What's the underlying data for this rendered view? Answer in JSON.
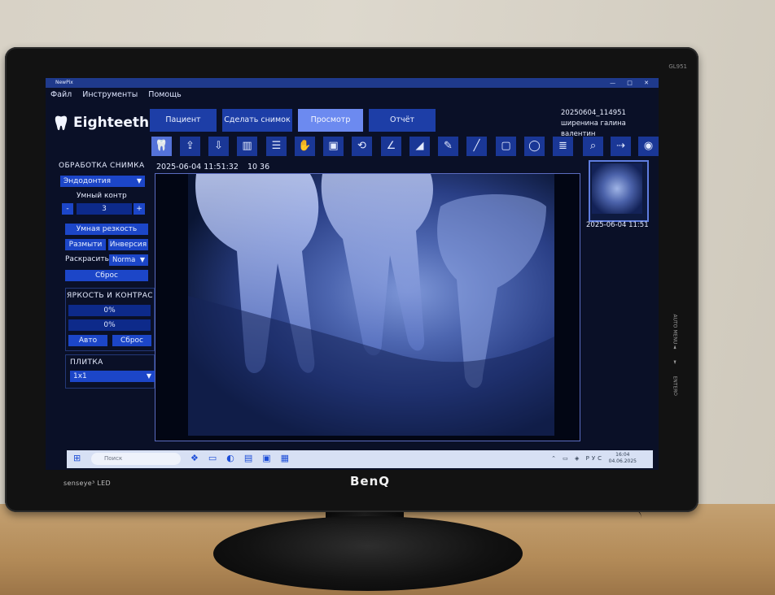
{
  "window": {
    "title": "NewPix",
    "controls": "— □ ✕"
  },
  "menu": [
    "Файл",
    "Инструменты",
    "Помощь"
  ],
  "logo": {
    "text": "Eighteeth"
  },
  "tabs": [
    {
      "label": "Пациент",
      "active": false
    },
    {
      "label": "Сделать снимок",
      "active": false
    },
    {
      "label": "Просмотр",
      "active": true
    },
    {
      "label": "Отчёт",
      "active": false
    }
  ],
  "patient": {
    "id": "20250604_114951",
    "name": "ширенина галина валентин"
  },
  "toolbar": [
    {
      "icon": "tooth-scan-icon",
      "glyph": "🦷"
    },
    {
      "icon": "import-image-icon",
      "glyph": "⇪"
    },
    {
      "icon": "export-image-icon",
      "glyph": "⇩"
    },
    {
      "icon": "columns-icon",
      "glyph": "▥"
    },
    {
      "icon": "layers-icon",
      "glyph": "☰"
    },
    {
      "icon": "hand-pan-icon",
      "glyph": "✋"
    },
    {
      "icon": "image-frame-icon",
      "glyph": "▣"
    },
    {
      "icon": "rotate-icon",
      "glyph": "⟲"
    },
    {
      "icon": "angle-icon",
      "glyph": "∠"
    },
    {
      "icon": "triangle-fill-icon",
      "glyph": "◢"
    },
    {
      "icon": "brush-icon",
      "glyph": "✎"
    },
    {
      "icon": "line-icon",
      "glyph": "╱"
    },
    {
      "icon": "rectangle-icon",
      "glyph": "▢"
    },
    {
      "icon": "ellipse-icon",
      "glyph": "◯"
    },
    {
      "icon": "notes-icon",
      "glyph": "≣"
    },
    {
      "icon": "magnifier-icon",
      "glyph": "⌕"
    },
    {
      "icon": "export-share-icon",
      "glyph": "⇢"
    },
    {
      "icon": "camera-icon",
      "glyph": "◉"
    }
  ],
  "image_processing": {
    "title": "ОБРАБОТКА СНИМКА",
    "preset": "Эндодонтия",
    "smart_contrast_label": "Умный контр",
    "smart_contrast_minus": "-",
    "smart_contrast_value": "3",
    "smart_contrast_plus": "+",
    "smart_sharpness": "Умная резкость",
    "blur": "Размыти",
    "invert": "Инверсия",
    "colorize_label": "Раскрасить",
    "colorize_value": "Norma",
    "reset": "Сброс"
  },
  "brightness_contrast": {
    "title": "ЯРКОСТЬ И КОНТРАС",
    "brightness": "0%",
    "contrast": "0%",
    "auto": "Авто",
    "reset": "Сброс"
  },
  "tile": {
    "title": "ПЛИТКА",
    "value": "1x1"
  },
  "viewer": {
    "date": "2025-06-04 11:51:32",
    "number": "10 36"
  },
  "thumbnail": {
    "date": "2025-06-04 11:51"
  },
  "taskbar": {
    "search": "Поиск",
    "time": "16:04",
    "date": "04.06.2025",
    "lang": "РУС"
  },
  "monitor": {
    "brand": "BenQ",
    "senseye": "senseye³  LED",
    "model": "GL951"
  }
}
